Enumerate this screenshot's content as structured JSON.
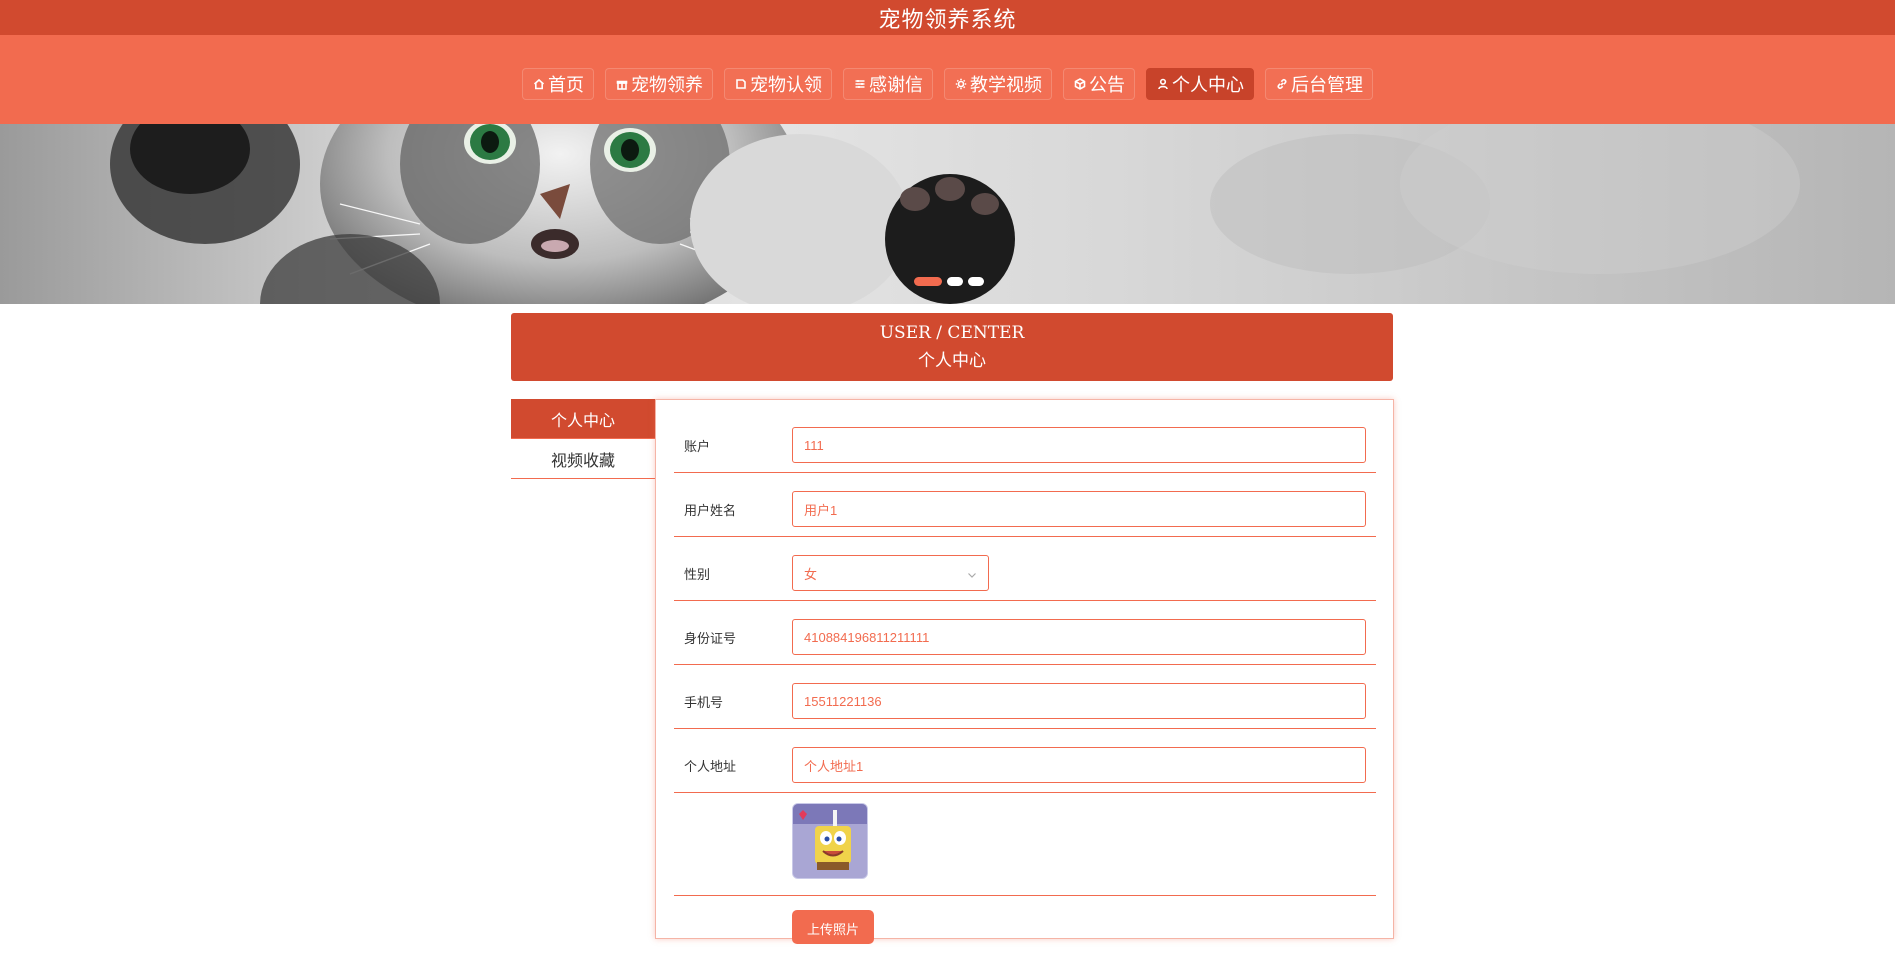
{
  "header": {
    "site_title": "宠物领养系统"
  },
  "nav": {
    "items": [
      {
        "label": "首页",
        "icon": "home-icon",
        "active": false
      },
      {
        "label": "宠物领养",
        "icon": "gift-icon",
        "active": false
      },
      {
        "label": "宠物认领",
        "icon": "tag-icon",
        "active": false
      },
      {
        "label": "感谢信",
        "icon": "sliders-icon",
        "active": false
      },
      {
        "label": "教学视频",
        "icon": "sun-icon",
        "active": false
      },
      {
        "label": "公告",
        "icon": "cube-icon",
        "active": false
      },
      {
        "label": "个人中心",
        "icon": "user-icon",
        "active": true
      },
      {
        "label": "后台管理",
        "icon": "link-icon",
        "active": false
      }
    ]
  },
  "banner": {
    "slide_count": 3,
    "active_slide": 1
  },
  "section": {
    "title_en": "USER / CENTER",
    "title_cn": "个人中心"
  },
  "sidebar": {
    "items": [
      {
        "label": "个人中心",
        "active": true
      },
      {
        "label": "视频收藏",
        "active": false
      }
    ]
  },
  "form": {
    "account": {
      "label": "账户",
      "value": "111"
    },
    "name": {
      "label": "用户姓名",
      "value": "用户1"
    },
    "gender": {
      "label": "性别",
      "value": "女"
    },
    "id_number": {
      "label": "身份证号",
      "value": "410884196811211111"
    },
    "phone": {
      "label": "手机号",
      "value": "15511221136"
    },
    "address": {
      "label": "个人地址",
      "value": "个人地址1"
    },
    "avatar": {
      "image": "spongebob-avatar"
    },
    "upload": {
      "label": "上传照片"
    }
  },
  "colors": {
    "primary": "#d14a2f",
    "accent": "#f26b4f"
  }
}
